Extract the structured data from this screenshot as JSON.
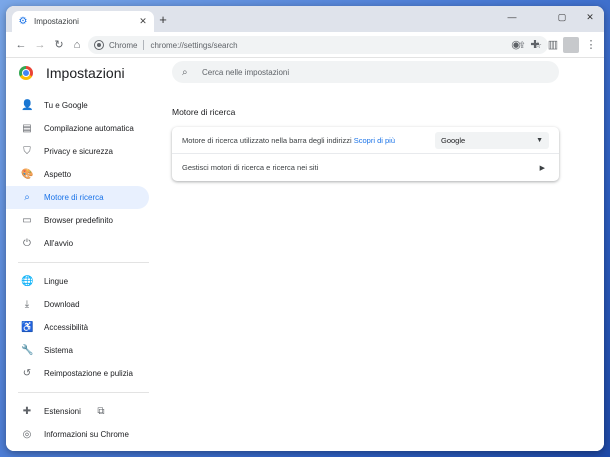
{
  "tab": {
    "title": "Impostazioni",
    "close": "✕"
  },
  "window": {
    "minimize": "—",
    "maximize": "▢",
    "close": "✕"
  },
  "newtab_label": "+",
  "omnibox": {
    "site": "Chrome",
    "url": "chrome://settings/search"
  },
  "settings": {
    "title": "Impostazioni",
    "search_placeholder": "Cerca nelle impostazioni"
  },
  "nav": {
    "group1": [
      {
        "name": "nav-you-and-google",
        "label": "Tu e Google",
        "icon": "👤",
        "active": false
      },
      {
        "name": "nav-autofill",
        "label": "Compilazione automatica",
        "icon": "▤",
        "active": false
      },
      {
        "name": "nav-privacy",
        "label": "Privacy e sicurezza",
        "icon": "⛉",
        "active": false
      },
      {
        "name": "nav-appearance",
        "label": "Aspetto",
        "icon": "🎨",
        "active": false
      },
      {
        "name": "nav-search-engine",
        "label": "Motore di ricerca",
        "icon": "⌕",
        "active": true
      },
      {
        "name": "nav-default-browser",
        "label": "Browser predefinito",
        "icon": "▭",
        "active": false
      },
      {
        "name": "nav-on-startup",
        "label": "All'avvio",
        "icon": "⏻",
        "active": false
      }
    ],
    "group2": [
      {
        "name": "nav-languages",
        "label": "Lingue",
        "icon": "🌐",
        "active": false
      },
      {
        "name": "nav-downloads",
        "label": "Download",
        "icon": "⤓",
        "active": false
      },
      {
        "name": "nav-accessibility",
        "label": "Accessibilità",
        "icon": "♿",
        "active": false
      },
      {
        "name": "nav-system",
        "label": "Sistema",
        "icon": "🔧",
        "active": false
      },
      {
        "name": "nav-reset",
        "label": "Reimpostazione e pulizia",
        "icon": "↺",
        "active": false
      }
    ],
    "group3": [
      {
        "name": "nav-extensions",
        "label": "Estensioni",
        "icon": "✚",
        "active": false,
        "external": "⧉"
      },
      {
        "name": "nav-about-chrome",
        "label": "Informazioni su Chrome",
        "icon": "◎",
        "active": false
      }
    ]
  },
  "main": {
    "section_title": "Motore di ricerca",
    "row1_text": "Motore di ricerca utilizzato nella barra degli indirizzi",
    "row1_link": "Scopri di più",
    "engine_value": "Google",
    "row2_text": "Gestisci motori di ricerca e ricerca nei siti"
  },
  "colors": {
    "accent": "#1a73e8",
    "active_bg": "#e8f0fe"
  }
}
